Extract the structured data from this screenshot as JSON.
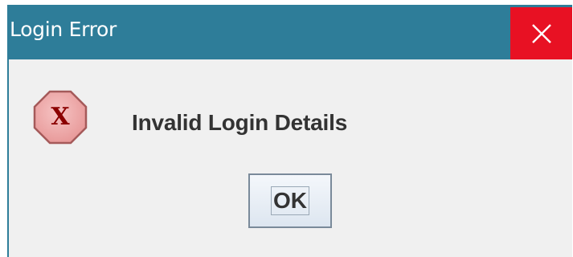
{
  "window": {
    "title": "Login Error",
    "close_icon": "close-icon",
    "titlebar_color": "#2e7d99",
    "close_color": "#e81123"
  },
  "dialog": {
    "icon": "error-icon",
    "icon_glyph": "X",
    "message": "Invalid Login Details",
    "ok_label": "OK"
  }
}
